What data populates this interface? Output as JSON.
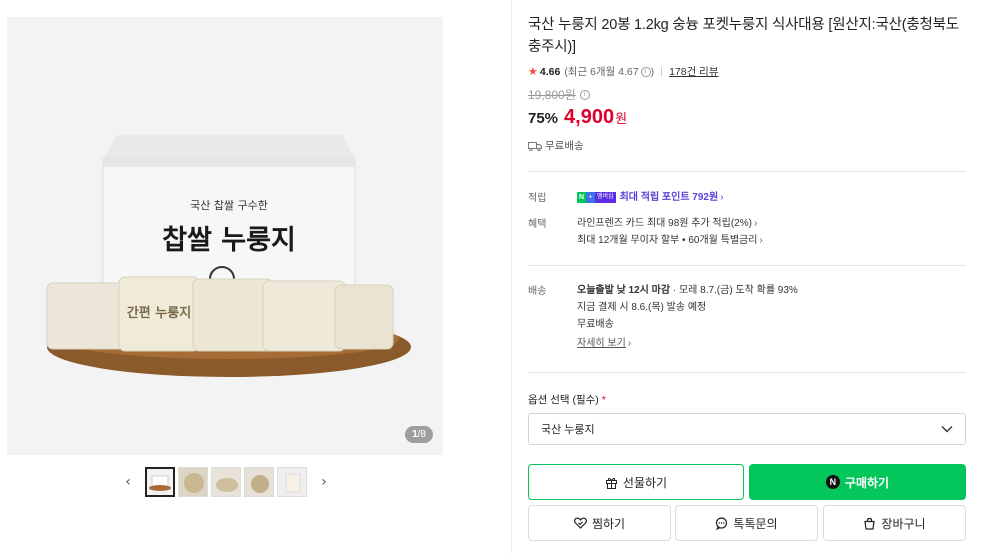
{
  "gallery": {
    "main_image_alt": "찹쌀 누룽지",
    "box_text_top": "국산 찹쌀 구수한",
    "box_text_main": "찹쌀 누룽지",
    "pack_text": "간편 누룽지",
    "page_current": "1",
    "page_total": "/8",
    "prev_icon": "chevron-left-icon",
    "next_icon": "chevron-right-icon",
    "thumb_count": 5
  },
  "product": {
    "title": "국산 누룽지 20봉 1.2kg 숭늉 포켓누룽지 식사대용 [원산지:국산(충청북도 충주시)]",
    "rating": "4.66",
    "recent_rating": "(최근 6개월 4.67",
    "recent_close": ")",
    "review_count": "178건 리뷰",
    "original_price": "19,800원",
    "discount": "75%",
    "price": "4,900",
    "currency": "원",
    "shipping_label": "무료배송"
  },
  "points": {
    "label": "적립",
    "badge_n": "N",
    "badge_plus": "+",
    "badge_member": "멤버십",
    "text": "최대 적립 포인트 792원",
    "chevron": "›"
  },
  "benefits": {
    "label": "혜택",
    "line1": "라인프렌즈 카드 최대 98원 추가 적립(2%)",
    "line2": "최대 12개월 무이자 할부 • 60개월 특별금리",
    "chevron": "›"
  },
  "delivery": {
    "label": "배송",
    "line1_bold": "오늘출발 낮 12시 마감",
    "line1_rest": " · 모레 8.7.(금) 도착 확률 93%",
    "line2": "지금 결제 시 8.6.(목) 발송 예정",
    "line3": "무료배송",
    "detail_link": "자세히 보기",
    "chevron": "›"
  },
  "option": {
    "label": "옵션 선택 (필수)",
    "required_mark": "*",
    "selected": "국산 누룽지"
  },
  "buttons": {
    "gift": "선물하기",
    "buy": "구매하기",
    "buy_icon_letter": "N",
    "like": "찜하기",
    "talk": "톡톡문의",
    "cart": "장바구니"
  },
  "colors": {
    "accent_green": "#03c75a",
    "price_red": "#e0002a",
    "points_purple": "#5b3fd8",
    "star": "#f04d3f"
  }
}
